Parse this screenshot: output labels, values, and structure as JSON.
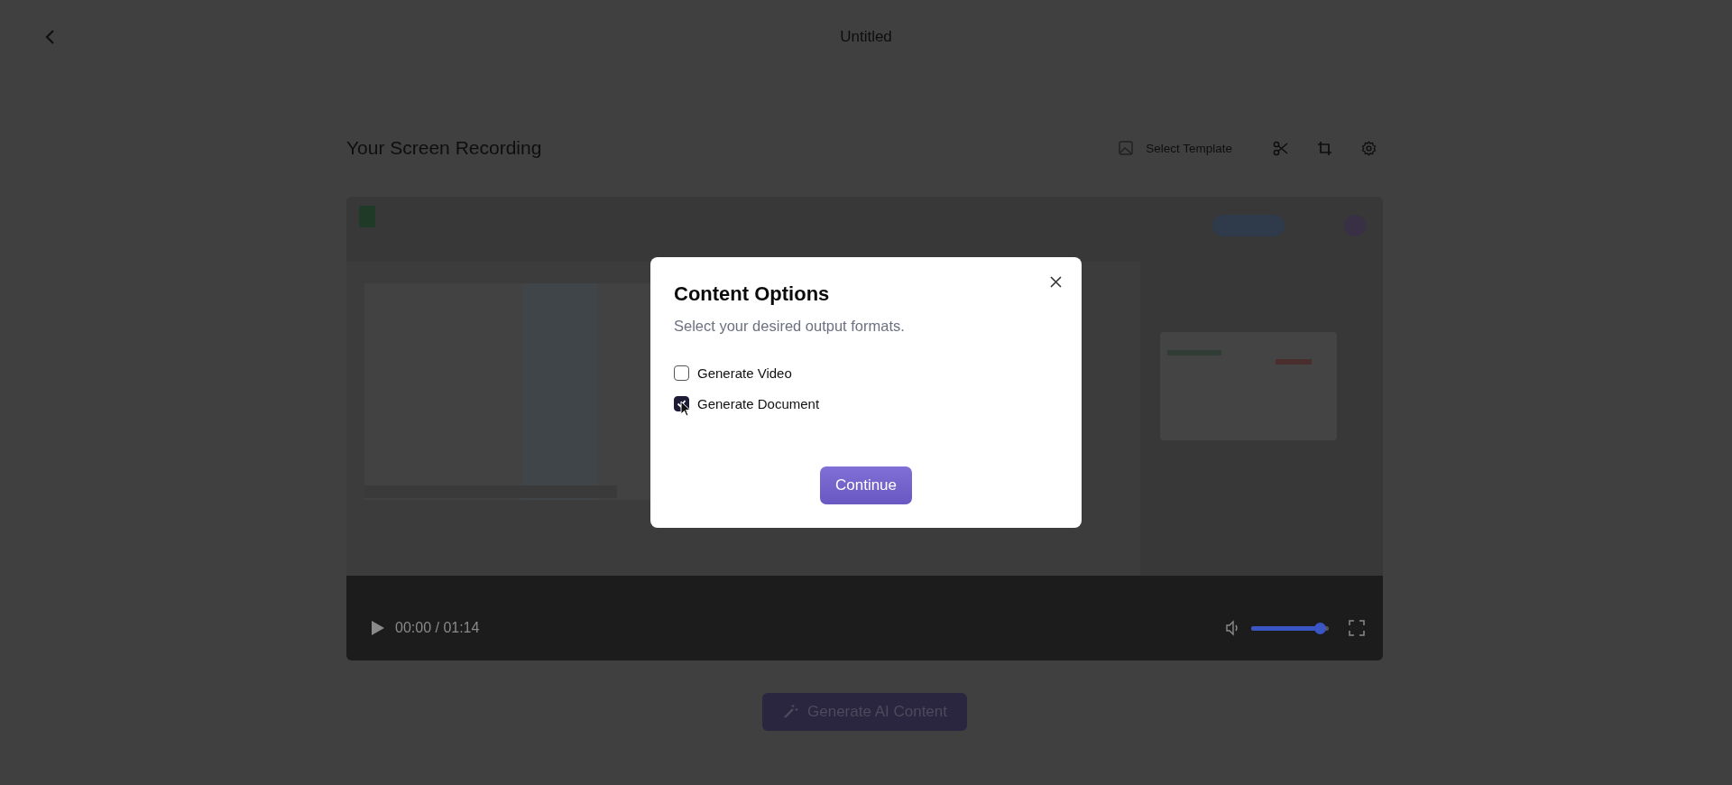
{
  "header": {
    "title": "Untitled"
  },
  "section": {
    "title": "Your Screen Recording"
  },
  "toolbar": {
    "template_button": "Select Template"
  },
  "video": {
    "kind": "picture",
    "time": "00:00 / 01:14",
    "volume": {
      "level": 0.88
    }
  },
  "generate_button": {
    "label": "Generate AI Content",
    "disabled": true
  },
  "dialog": {
    "title": "Content Options",
    "subtitle": "Select your desired output formats.",
    "options": [
      {
        "label": "Generate Video",
        "checked": false
      },
      {
        "label": "Generate Document",
        "checked": true
      }
    ],
    "continue_button": "Continue"
  }
}
